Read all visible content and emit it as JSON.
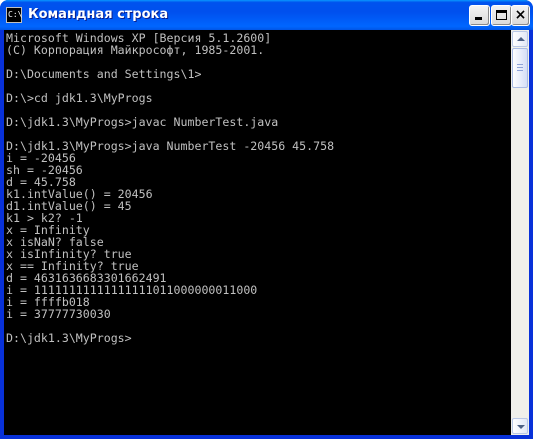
{
  "window": {
    "title": "Командная строка",
    "icon_text": "C:\\"
  },
  "console": {
    "lines": [
      "Microsoft Windows XP [Версия 5.1.2600]",
      "(С) Корпорация Майкрософт, 1985-2001.",
      "",
      "D:\\Documents and Settings\\1>",
      "",
      "D:\\>cd jdk1.3\\MyProgs",
      "",
      "D:\\jdk1.3\\MyProgs>javac NumberTest.java",
      "",
      "D:\\jdk1.3\\MyProgs>java NumberTest -20456 45.758",
      "i = -20456",
      "sh = -20456",
      "d = 45.758",
      "k1.intValue() = 20456",
      "d1.intValue() = 45",
      "k1 > k2? -1",
      "x = Infinity",
      "x isNaN? false",
      "x isInfinity? true",
      "x == Infinity? true",
      "d = 4631636683301662491",
      "i = 11111111111111111011000000011000",
      "i = ffffb018",
      "i = 37777730030",
      "",
      "D:\\jdk1.3\\MyProgs>"
    ]
  },
  "icons": {
    "minimize": "minimize-icon",
    "maximize": "maximize-icon",
    "close": "close-icon",
    "close_glyph": "×",
    "scroll_up": "arrow-up-icon",
    "scroll_down": "arrow-down-icon"
  },
  "colors": {
    "titlebar": "#0054e3",
    "console_bg": "#000000",
    "console_text": "#c0c0c0"
  }
}
